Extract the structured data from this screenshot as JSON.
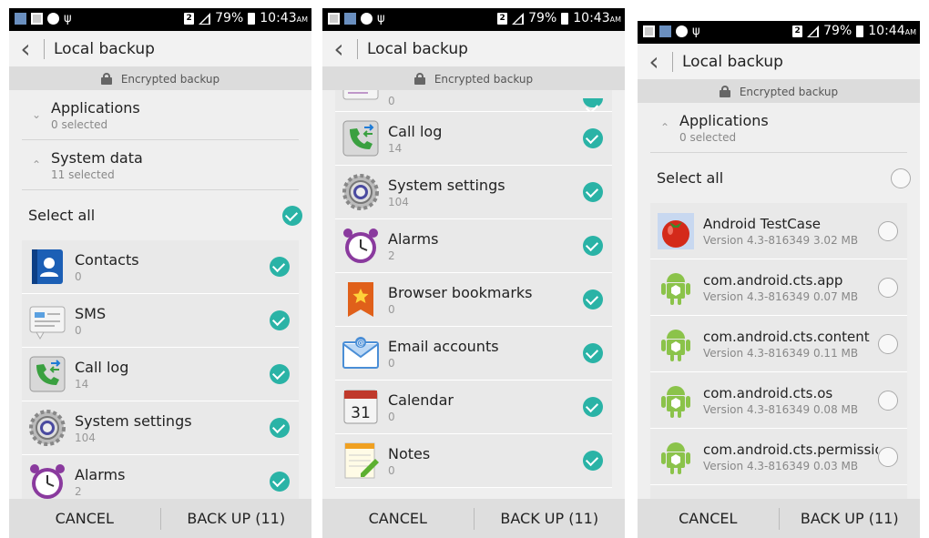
{
  "common": {
    "title": "Local backup",
    "encrypted": "Encrypted backup",
    "cancel": "CANCEL",
    "backup": "BACK UP (11)",
    "battery": "79%"
  },
  "s1": {
    "time": "10:43",
    "ampm": "AM",
    "sections": [
      {
        "title": "Applications",
        "sub": "0 selected",
        "chevron": "⌄"
      },
      {
        "title": "System data",
        "sub": "11 selected",
        "chevron": "⌃"
      }
    ],
    "select_all": "Select all",
    "items": [
      {
        "name": "Contacts",
        "count": "0",
        "icon": "contacts-icon"
      },
      {
        "name": "SMS",
        "count": "0",
        "icon": "sms-icon"
      },
      {
        "name": "Call log",
        "count": "14",
        "icon": "call-log-icon"
      },
      {
        "name": "System settings",
        "count": "104",
        "icon": "settings-icon"
      },
      {
        "name": "Alarms",
        "count": "2",
        "icon": "alarm-icon"
      }
    ]
  },
  "s2": {
    "time": "10:43",
    "ampm": "AM",
    "partial_count": "0",
    "items": [
      {
        "name": "Call log",
        "count": "14",
        "icon": "call-log-icon"
      },
      {
        "name": "System settings",
        "count": "104",
        "icon": "settings-icon"
      },
      {
        "name": "Alarms",
        "count": "2",
        "icon": "alarm-icon"
      },
      {
        "name": "Browser bookmarks",
        "count": "0",
        "icon": "bookmark-icon"
      },
      {
        "name": "Email accounts",
        "count": "0",
        "icon": "email-icon"
      },
      {
        "name": "Calendar",
        "count": "0",
        "icon": "calendar-icon",
        "day": "31"
      },
      {
        "name": "Notes",
        "count": "0",
        "icon": "notes-icon"
      }
    ]
  },
  "s3": {
    "time": "10:44",
    "ampm": "AM",
    "section": {
      "title": "Applications",
      "sub": "0 selected",
      "chevron": "⌃"
    },
    "select_all": "Select all",
    "apps": [
      {
        "name": "Android TestCase",
        "info": "Version 4.3-816349 3.02 MB",
        "icon": "tomato-icon"
      },
      {
        "name": "com.android.cts.app",
        "info": "Version 4.3-816349 0.07 MB",
        "icon": "android-icon"
      },
      {
        "name": "com.android.cts.content",
        "info": "Version 4.3-816349 0.11 MB",
        "icon": "android-icon"
      },
      {
        "name": "com.android.cts.os",
        "info": "Version 4.3-816349 0.08 MB",
        "icon": "android-icon"
      },
      {
        "name": "com.android.cts.permission",
        "info": "Version 4.3-816349 0.03 MB",
        "icon": "android-icon"
      }
    ]
  },
  "colors": {
    "check": "#2ab3a6",
    "header_bg": "#f2f2f2",
    "banner_bg": "#dcdcdc"
  }
}
